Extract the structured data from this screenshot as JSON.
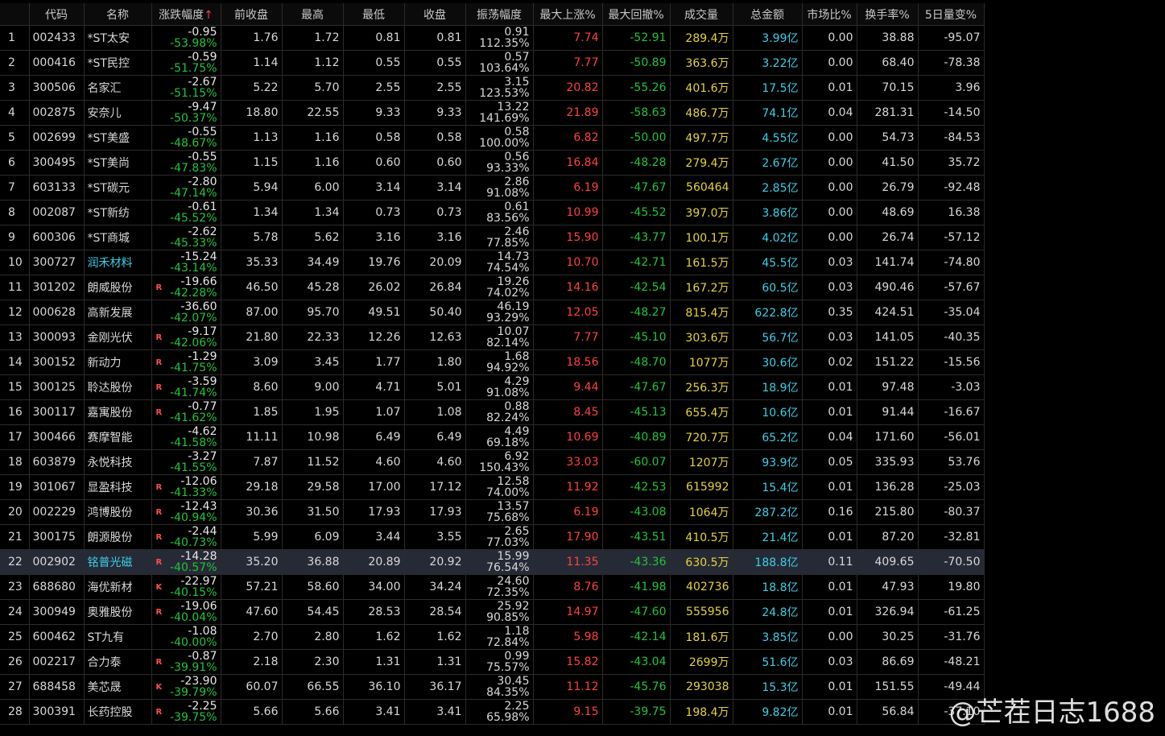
{
  "columns": [
    "",
    "代码",
    "名称",
    "涨跌幅度",
    "前收盘",
    "最高",
    "最低",
    "收盘",
    "振荡幅度",
    "最大上涨%",
    "最大回撤%",
    "成交量",
    "总金额",
    "市场比%",
    "换手率%",
    "5日量变%"
  ],
  "sort_arrow": "↑",
  "rows": [
    {
      "idx": "1",
      "code": "002433",
      "name": "*ST太安",
      "mark": "",
      "chg": "-0.95",
      "chgpct": "-53.98%",
      "pre": "1.76",
      "high": "1.72",
      "low": "0.81",
      "close": "0.81",
      "osc": "0.91",
      "oscpct": "112.35%",
      "maxup": "7.74",
      "maxdd": "-52.91",
      "vol": "289.4万",
      "amt": "3.99亿",
      "mkt": "0.00",
      "turn": "38.88",
      "vol5": "-95.07"
    },
    {
      "idx": "2",
      "code": "000416",
      "name": "*ST民控",
      "mark": "",
      "chg": "-0.59",
      "chgpct": "-51.75%",
      "pre": "1.14",
      "high": "1.12",
      "low": "0.55",
      "close": "0.55",
      "osc": "0.57",
      "oscpct": "103.64%",
      "maxup": "7.77",
      "maxdd": "-50.89",
      "vol": "363.6万",
      "amt": "3.22亿",
      "mkt": "0.00",
      "turn": "68.40",
      "vol5": "-78.38"
    },
    {
      "idx": "3",
      "code": "300506",
      "name": "名家汇",
      "mark": "",
      "chg": "-2.67",
      "chgpct": "-51.15%",
      "pre": "5.22",
      "high": "5.70",
      "low": "2.55",
      "close": "2.55",
      "osc": "3.15",
      "oscpct": "123.53%",
      "maxup": "20.82",
      "maxdd": "-55.26",
      "vol": "401.6万",
      "amt": "17.5亿",
      "mkt": "0.01",
      "turn": "70.15",
      "vol5": "3.96"
    },
    {
      "idx": "4",
      "code": "002875",
      "name": "安奈儿",
      "mark": "",
      "chg": "-9.47",
      "chgpct": "-50.37%",
      "pre": "18.80",
      "high": "22.55",
      "low": "9.33",
      "close": "9.33",
      "osc": "13.22",
      "oscpct": "141.69%",
      "maxup": "21.89",
      "maxdd": "-58.63",
      "vol": "486.7万",
      "amt": "74.1亿",
      "mkt": "0.04",
      "turn": "281.31",
      "vol5": "-14.50"
    },
    {
      "idx": "5",
      "code": "002699",
      "name": "*ST美盛",
      "mark": "",
      "chg": "-0.55",
      "chgpct": "-48.67%",
      "pre": "1.13",
      "high": "1.16",
      "low": "0.58",
      "close": "0.58",
      "osc": "0.58",
      "oscpct": "100.00%",
      "maxup": "6.82",
      "maxdd": "-50.00",
      "vol": "497.7万",
      "amt": "4.55亿",
      "mkt": "0.00",
      "turn": "54.73",
      "vol5": "-84.53"
    },
    {
      "idx": "6",
      "code": "300495",
      "name": "*ST美尚",
      "mark": "",
      "chg": "-0.55",
      "chgpct": "-47.83%",
      "pre": "1.15",
      "high": "1.16",
      "low": "0.60",
      "close": "0.60",
      "osc": "0.56",
      "oscpct": "93.33%",
      "maxup": "16.84",
      "maxdd": "-48.28",
      "vol": "279.4万",
      "amt": "2.67亿",
      "mkt": "0.00",
      "turn": "41.50",
      "vol5": "35.72"
    },
    {
      "idx": "7",
      "code": "603133",
      "name": "*ST碳元",
      "mark": "",
      "chg": "-2.80",
      "chgpct": "-47.14%",
      "pre": "5.94",
      "high": "6.00",
      "low": "3.14",
      "close": "3.14",
      "osc": "2.86",
      "oscpct": "91.08%",
      "maxup": "6.19",
      "maxdd": "-47.67",
      "vol": "560464",
      "amt": "2.85亿",
      "mkt": "0.00",
      "turn": "26.79",
      "vol5": "-92.48"
    },
    {
      "idx": "8",
      "code": "002087",
      "name": "*ST新纺",
      "mark": "",
      "chg": "-0.61",
      "chgpct": "-45.52%",
      "pre": "1.34",
      "high": "1.34",
      "low": "0.73",
      "close": "0.73",
      "osc": "0.61",
      "oscpct": "83.56%",
      "maxup": "10.99",
      "maxdd": "-45.52",
      "vol": "397.0万",
      "amt": "3.86亿",
      "mkt": "0.00",
      "turn": "48.69",
      "vol5": "16.38"
    },
    {
      "idx": "9",
      "code": "600306",
      "name": "*ST商城",
      "mark": "",
      "chg": "-2.62",
      "chgpct": "-45.33%",
      "pre": "5.78",
      "high": "5.62",
      "low": "3.16",
      "close": "3.16",
      "osc": "2.46",
      "oscpct": "77.85%",
      "maxup": "15.90",
      "maxdd": "-43.77",
      "vol": "100.1万",
      "amt": "4.02亿",
      "mkt": "0.00",
      "turn": "26.74",
      "vol5": "-57.12"
    },
    {
      "idx": "10",
      "code": "300727",
      "name": "润禾材料",
      "mark": "",
      "cyan": true,
      "chg": "-15.24",
      "chgpct": "-43.14%",
      "pre": "35.33",
      "high": "34.49",
      "low": "19.76",
      "close": "20.09",
      "osc": "14.73",
      "oscpct": "74.54%",
      "maxup": "10.70",
      "maxdd": "-42.71",
      "vol": "161.5万",
      "amt": "45.5亿",
      "mkt": "0.03",
      "turn": "141.74",
      "vol5": "-74.80"
    },
    {
      "idx": "11",
      "code": "301202",
      "name": "朗威股份",
      "mark": "R",
      "chg": "-19.66",
      "chgpct": "-42.28%",
      "pre": "46.50",
      "high": "45.28",
      "low": "26.02",
      "close": "26.84",
      "osc": "19.26",
      "oscpct": "74.02%",
      "maxup": "14.16",
      "maxdd": "-42.54",
      "vol": "167.2万",
      "amt": "60.5亿",
      "mkt": "0.03",
      "turn": "490.46",
      "vol5": "-57.67"
    },
    {
      "idx": "12",
      "code": "000628",
      "name": "高新发展",
      "mark": "",
      "chg": "-36.60",
      "chgpct": "-42.07%",
      "pre": "87.00",
      "high": "95.70",
      "low": "49.51",
      "close": "50.40",
      "osc": "46.19",
      "oscpct": "93.29%",
      "maxup": "12.05",
      "maxdd": "-48.27",
      "vol": "815.4万",
      "amt": "622.8亿",
      "mkt": "0.35",
      "turn": "424.51",
      "vol5": "-35.04"
    },
    {
      "idx": "13",
      "code": "300093",
      "name": "金刚光伏",
      "mark": "R",
      "chg": "-9.17",
      "chgpct": "-42.06%",
      "pre": "21.80",
      "high": "22.33",
      "low": "12.26",
      "close": "12.63",
      "osc": "10.07",
      "oscpct": "82.14%",
      "maxup": "7.77",
      "maxdd": "-45.10",
      "vol": "303.6万",
      "amt": "56.7亿",
      "mkt": "0.03",
      "turn": "141.05",
      "vol5": "-40.35"
    },
    {
      "idx": "14",
      "code": "300152",
      "name": "新动力",
      "mark": "R",
      "chg": "-1.29",
      "chgpct": "-41.75%",
      "pre": "3.09",
      "high": "3.45",
      "low": "1.77",
      "close": "1.80",
      "osc": "1.68",
      "oscpct": "94.92%",
      "maxup": "18.56",
      "maxdd": "-48.70",
      "vol": "1077万",
      "amt": "30.6亿",
      "mkt": "0.02",
      "turn": "151.22",
      "vol5": "-15.56"
    },
    {
      "idx": "15",
      "code": "300125",
      "name": "聆达股份",
      "mark": "R",
      "chg": "-3.59",
      "chgpct": "-41.74%",
      "pre": "8.60",
      "high": "9.00",
      "low": "4.71",
      "close": "5.01",
      "osc": "4.29",
      "oscpct": "91.08%",
      "maxup": "9.44",
      "maxdd": "-47.67",
      "vol": "256.3万",
      "amt": "18.9亿",
      "mkt": "0.01",
      "turn": "97.48",
      "vol5": "-3.03"
    },
    {
      "idx": "16",
      "code": "300117",
      "name": "嘉寓股份",
      "mark": "R",
      "chg": "-0.77",
      "chgpct": "-41.62%",
      "pre": "1.85",
      "high": "1.95",
      "low": "1.07",
      "close": "1.08",
      "osc": "0.88",
      "oscpct": "82.24%",
      "maxup": "8.45",
      "maxdd": "-45.13",
      "vol": "655.4万",
      "amt": "10.6亿",
      "mkt": "0.01",
      "turn": "91.44",
      "vol5": "-16.67"
    },
    {
      "idx": "17",
      "code": "300466",
      "name": "赛摩智能",
      "mark": "",
      "chg": "-4.62",
      "chgpct": "-41.58%",
      "pre": "11.11",
      "high": "10.98",
      "low": "6.49",
      "close": "6.49",
      "osc": "4.49",
      "oscpct": "69.18%",
      "maxup": "10.69",
      "maxdd": "-40.89",
      "vol": "720.7万",
      "amt": "65.2亿",
      "mkt": "0.04",
      "turn": "171.60",
      "vol5": "-56.01"
    },
    {
      "idx": "18",
      "code": "603879",
      "name": "永悦科技",
      "mark": "",
      "chg": "-3.27",
      "chgpct": "-41.55%",
      "pre": "7.87",
      "high": "11.52",
      "low": "4.60",
      "close": "4.60",
      "osc": "6.92",
      "oscpct": "150.43%",
      "maxup": "33.03",
      "maxdd": "-60.07",
      "vol": "1207万",
      "amt": "93.9亿",
      "mkt": "0.05",
      "turn": "335.93",
      "vol5": "53.76"
    },
    {
      "idx": "19",
      "code": "301067",
      "name": "显盈科技",
      "mark": "R",
      "chg": "-12.06",
      "chgpct": "-41.33%",
      "pre": "29.18",
      "high": "29.58",
      "low": "17.00",
      "close": "17.12",
      "osc": "12.58",
      "oscpct": "74.00%",
      "maxup": "11.92",
      "maxdd": "-42.53",
      "vol": "615992",
      "amt": "15.4亿",
      "mkt": "0.01",
      "turn": "136.28",
      "vol5": "-25.03"
    },
    {
      "idx": "20",
      "code": "002229",
      "name": "鸿博股份",
      "mark": "R",
      "chg": "-12.43",
      "chgpct": "-40.94%",
      "pre": "30.36",
      "high": "31.50",
      "low": "17.93",
      "close": "17.93",
      "osc": "13.57",
      "oscpct": "75.68%",
      "maxup": "6.19",
      "maxdd": "-43.08",
      "vol": "1064万",
      "amt": "287.2亿",
      "mkt": "0.16",
      "turn": "215.80",
      "vol5": "-80.37"
    },
    {
      "idx": "21",
      "code": "300175",
      "name": "朗源股份",
      "mark": "R",
      "chg": "-2.44",
      "chgpct": "-40.73%",
      "pre": "5.99",
      "high": "6.09",
      "low": "3.44",
      "close": "3.55",
      "osc": "2.65",
      "oscpct": "77.03%",
      "maxup": "17.90",
      "maxdd": "-43.51",
      "vol": "410.5万",
      "amt": "21.4亿",
      "mkt": "0.01",
      "turn": "87.20",
      "vol5": "-32.81"
    },
    {
      "idx": "22",
      "code": "002902",
      "name": "铭普光磁",
      "mark": "R",
      "cyan": true,
      "selected": true,
      "chg": "-14.28",
      "chgpct": "-40.57%",
      "pre": "35.20",
      "high": "36.88",
      "low": "20.89",
      "close": "20.92",
      "osc": "15.99",
      "oscpct": "76.54%",
      "maxup": "11.35",
      "maxdd": "-43.36",
      "vol": "630.5万",
      "amt": "188.8亿",
      "mkt": "0.11",
      "turn": "409.65",
      "vol5": "-70.50"
    },
    {
      "idx": "23",
      "code": "688680",
      "name": "海优新材",
      "mark": "K",
      "chg": "-22.97",
      "chgpct": "-40.15%",
      "pre": "57.21",
      "high": "58.60",
      "low": "34.00",
      "close": "34.24",
      "osc": "24.60",
      "oscpct": "72.35%",
      "maxup": "8.76",
      "maxdd": "-41.98",
      "vol": "402736",
      "amt": "18.8亿",
      "mkt": "0.01",
      "turn": "47.93",
      "vol5": "19.80"
    },
    {
      "idx": "24",
      "code": "300949",
      "name": "奥雅股份",
      "mark": "R",
      "chg": "-19.06",
      "chgpct": "-40.04%",
      "pre": "47.60",
      "high": "54.45",
      "low": "28.53",
      "close": "28.54",
      "osc": "25.92",
      "oscpct": "90.85%",
      "maxup": "14.97",
      "maxdd": "-47.60",
      "vol": "555956",
      "amt": "24.8亿",
      "mkt": "0.01",
      "turn": "326.94",
      "vol5": "-61.25"
    },
    {
      "idx": "25",
      "code": "600462",
      "name": "ST九有",
      "mark": "",
      "chg": "-1.08",
      "chgpct": "-40.00%",
      "pre": "2.70",
      "high": "2.80",
      "low": "1.62",
      "close": "1.62",
      "osc": "1.18",
      "oscpct": "72.84%",
      "maxup": "5.98",
      "maxdd": "-42.14",
      "vol": "181.6万",
      "amt": "3.85亿",
      "mkt": "0.00",
      "turn": "30.25",
      "vol5": "-31.76"
    },
    {
      "idx": "26",
      "code": "002217",
      "name": "合力泰",
      "mark": "R",
      "chg": "-0.87",
      "chgpct": "-39.91%",
      "pre": "2.18",
      "high": "2.30",
      "low": "1.31",
      "close": "1.31",
      "osc": "0.99",
      "oscpct": "75.57%",
      "maxup": "15.82",
      "maxdd": "-43.04",
      "vol": "2699万",
      "amt": "51.6亿",
      "mkt": "0.03",
      "turn": "86.69",
      "vol5": "-48.21"
    },
    {
      "idx": "27",
      "code": "688458",
      "name": "美芯晟",
      "mark": "K",
      "chg": "-23.90",
      "chgpct": "-39.79%",
      "pre": "60.07",
      "high": "66.55",
      "low": "36.10",
      "close": "36.17",
      "osc": "30.45",
      "oscpct": "84.35%",
      "maxup": "11.12",
      "maxdd": "-45.76",
      "vol": "293038",
      "amt": "15.3亿",
      "mkt": "0.01",
      "turn": "151.55",
      "vol5": "-49.44"
    },
    {
      "idx": "28",
      "code": "300391",
      "name": "长药控股",
      "mark": "R",
      "chg": "-2.25",
      "chgpct": "-39.75%",
      "pre": "5.66",
      "high": "5.66",
      "low": "3.41",
      "close": "3.41",
      "osc": "2.25",
      "oscpct": "65.98%",
      "maxup": "9.15",
      "maxdd": "-39.75",
      "vol": "198.4万",
      "amt": "9.82亿",
      "mkt": "0.01",
      "turn": "56.84",
      "vol5": "-37.10"
    }
  ],
  "watermark": "@芒茬日志1688",
  "colors": {
    "up": "#ff4040",
    "down": "#22c33a",
    "volume": "#e6d23a",
    "amount": "#3ad0e6",
    "selected_row": "#262a36"
  }
}
